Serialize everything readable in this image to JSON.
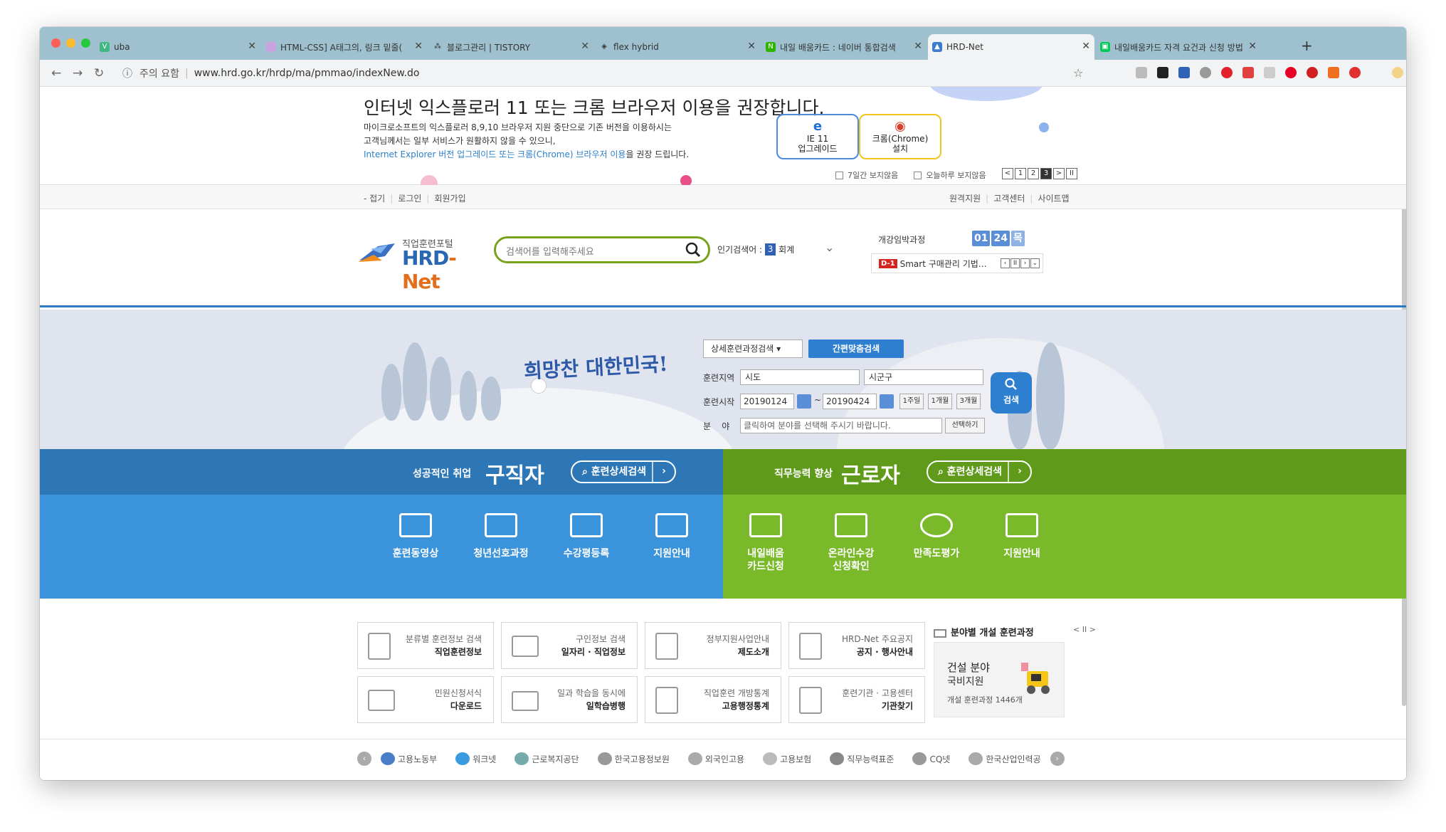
{
  "browser": {
    "tabs": [
      {
        "title": "uba",
        "active": false,
        "favicon": "vue-icon"
      },
      {
        "title": "HTML-CSS] A태그의, 링크 밑줄(",
        "active": false,
        "favicon": "stripe-icon"
      },
      {
        "title": "블로그관리 | TISTORY",
        "active": false,
        "favicon": "tistory-icon"
      },
      {
        "title": "flex hybrid",
        "active": false,
        "favicon": "codepen-icon"
      },
      {
        "title": "내일 배움카드 : 네이버 통합검색",
        "active": false,
        "favicon": "naver-icon"
      },
      {
        "title": "HRD-Net",
        "active": true,
        "favicon": "hrd-icon"
      },
      {
        "title": "내일배움카드 자격 요건과 신청 방법",
        "active": false,
        "favicon": "blog-icon"
      }
    ],
    "address": {
      "security": "주의 요함",
      "url": "www.hrd.go.kr/hrdp/ma/pmmao/indexNew.do"
    }
  },
  "notice": {
    "title": "인터넷 익스플로러 11 또는 크롬 브라우저 이용을 권장합니다.",
    "line1": "마이크로소프트의 익스플로러 8,9,10 브라우저 지원 중단으로 기존 버전을 이용하시는",
    "line2": "고객님께서는 일부 서비스가 원활하지 않을 수 있으니,",
    "line3_link": "Internet Explorer 버전 업그레이드 또는 크롬(Chrome) 브라우저 이용",
    "line3_rest": "을 권장 드립니다.",
    "ie_line1": "IE 11",
    "ie_line2": "업그레이드",
    "chrome_line1": "크롬(Chrome)",
    "chrome_line2": "설치",
    "opt7days": "7일간 보지않음",
    "opttoday": "오늘하루 보지않음",
    "pages": [
      "<",
      "1",
      "2",
      "3",
      ">",
      "II"
    ]
  },
  "util": {
    "left": [
      "- 접기",
      "로그인",
      "회원가입"
    ],
    "right": [
      "원격지원",
      "고객센터",
      "사이트맵"
    ]
  },
  "header": {
    "logo_small": "직업훈련포털",
    "logo_big1": "HRD",
    "logo_big2": "-Net",
    "search_placeholder": "검색어를 입력해주세요",
    "popular_label": "인기검색어 :",
    "popular_num": "3",
    "popular_word": "회계",
    "open_title": "개강임박과정",
    "date": [
      "01",
      "24",
      "목"
    ],
    "dday": "D-1",
    "ticker_text": "Smart 구매관리 기법…"
  },
  "banner": {
    "slogan": "희망찬 대한민국!",
    "detail_select": "상세훈련과정검색",
    "easy_search": "간편맞춤검색",
    "region_label": "훈련지역",
    "region1": "시도",
    "region2": "시군구",
    "start_label": "훈련시작",
    "date_from": "20190124",
    "tilde": "~",
    "date_to": "20190424",
    "periods": [
      "1주일",
      "1개월",
      "3개월"
    ],
    "field_label": "분    야",
    "field_placeholder": "클릭하여 분야를 선택해 주시기 바랍니다.",
    "field_btn": "선택하기",
    "search_btn": "검색"
  },
  "jobseeker": {
    "sub": "성공적인 취업",
    "title": "구직자",
    "pill": "훈련상세검색",
    "items": [
      "훈련동영상",
      "청년선호과정",
      "수강평등록",
      "지원안내"
    ]
  },
  "worker": {
    "sub": "직무능력 향상",
    "title": "근로자",
    "pill": "훈련상세검색",
    "items": [
      [
        "내일배움",
        "카드신청"
      ],
      [
        "온라인수강",
        "신청확인"
      ],
      [
        "만족도평가",
        ""
      ],
      [
        "지원안내",
        ""
      ]
    ]
  },
  "boxes": [
    {
      "a": "분류별 훈련정보 검색",
      "b": "직업훈련정보"
    },
    {
      "a": "구인정보 검색",
      "b": "일자리 · 직업정보"
    },
    {
      "a": "정부지원사업안내",
      "b": "제도소개"
    },
    {
      "a": "HRD-Net 주요공지",
      "b": "공지 · 행사안내"
    },
    {
      "a": "민원신청서식",
      "b": "다운로드"
    },
    {
      "a": "일과 학습을 동시에",
      "b": "일학습병행"
    },
    {
      "a": "직업훈련 개방통계",
      "b": "고용행정통계"
    },
    {
      "a": "훈련기관 · 고용센터",
      "b": "기관찾기"
    }
  ],
  "field": {
    "title": "분야별 개설 훈련과정",
    "ctrl": "< II >",
    "name": "건설 분야",
    "sub": "국비지원",
    "count": "개설 훈련과정 1446개"
  },
  "partners": [
    "고용노동부",
    "워크넷",
    "근로복지공단",
    "한국고용정보원",
    "외국인고용",
    "고용보험",
    "직무능력표준",
    "CQ넷",
    "한국산업인력공"
  ],
  "colors": {
    "blue": "#3b93dc",
    "green": "#7ab929",
    "accent": "#2f7fd0"
  }
}
